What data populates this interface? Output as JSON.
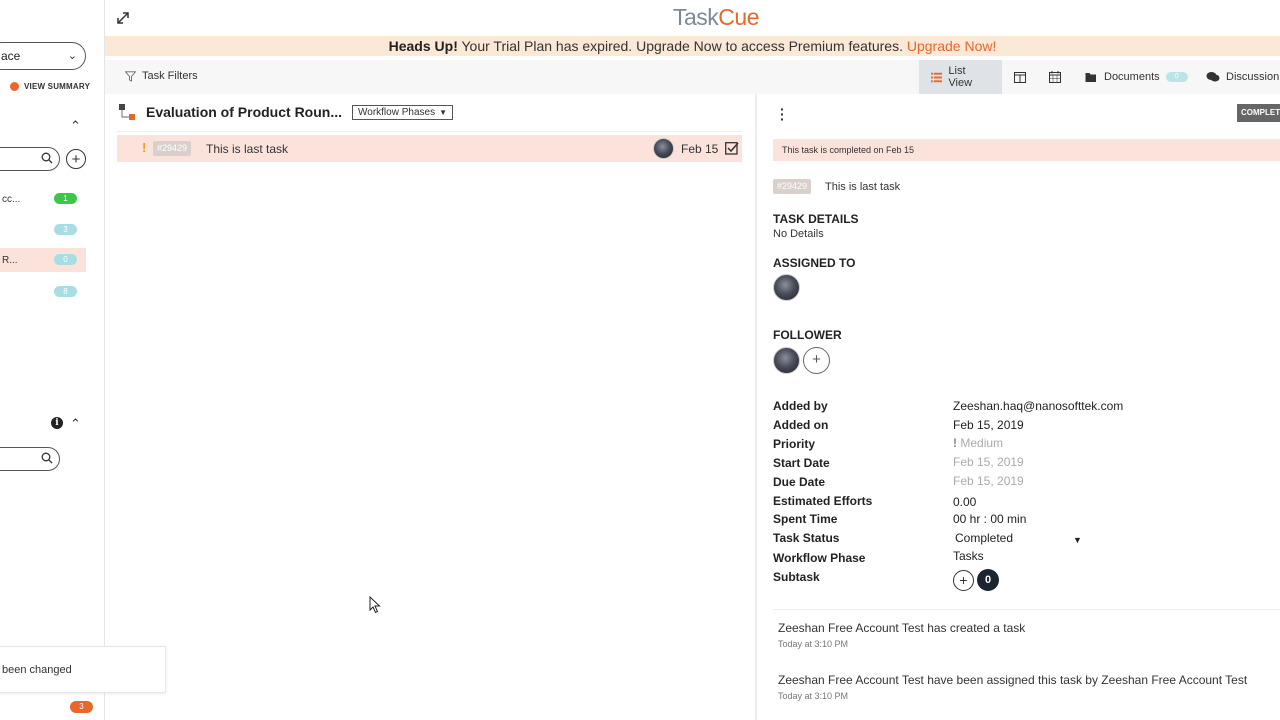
{
  "sidebar": {
    "workspace_label": "ace",
    "view_summary": "VIEW SUMMARY",
    "projects": [
      {
        "name": "cc...",
        "count": "1",
        "color": "#3cc74a"
      },
      {
        "name": "",
        "count": "3",
        "color": "#a8dde4"
      },
      {
        "name": "R...",
        "count": "0",
        "color": "#a8dde4"
      },
      {
        "name": "",
        "count": "8",
        "color": "#a8dde4"
      }
    ],
    "toast_text": "been changed",
    "bottom_badge": "3"
  },
  "header": {
    "logo_prefix": "Task",
    "logo_accent": "Cue"
  },
  "banner": {
    "bold": "Heads Up!",
    "message": " Your Trial Plan has expired. Upgrade Now to access Premium features. ",
    "link": "Upgrade Now!"
  },
  "toolbar": {
    "task_filters": "Task Filters",
    "list_view": "List View",
    "documents": "Documents",
    "documents_count": "0",
    "discussion": "Discussion"
  },
  "list": {
    "phase_title": "Evaluation of Product Roun...",
    "workflow_select": "Workflow Phases",
    "tasks": [
      {
        "id": "#29429",
        "name": "This is last task",
        "date": "Feb 15"
      }
    ]
  },
  "detail": {
    "status_tag": "COMPLETE",
    "completed_note": "This task is completed on Feb 15",
    "task_id": "#29429",
    "task_name": "This is last task",
    "task_details_label": "TASK DETAILS",
    "task_details_value": "No Details",
    "assigned_to_label": "ASSIGNED TO",
    "follower_label": "FOLLOWER",
    "props": {
      "added_by_label": "Added by",
      "added_by": "Zeeshan.haq@nanosofttek.com",
      "added_on_label": "Added on",
      "added_on": "Feb 15, 2019",
      "priority_label": "Priority",
      "priority": "Medium",
      "start_date_label": "Start Date",
      "start_date": "Feb 15, 2019",
      "due_date_label": "Due Date",
      "due_date": "Feb 15, 2019",
      "estimated_label": "Estimated Efforts",
      "estimated": "0.00",
      "spent_label": "Spent Time",
      "spent": "00 hr : 00 min",
      "status_label": "Task Status",
      "status": "Completed",
      "phase_label": "Workflow Phase",
      "phase": "Tasks",
      "subtask_label": "Subtask",
      "subtask_count": "0"
    },
    "activity": [
      {
        "text": "Zeeshan Free Account Test has created a task",
        "time": "Today at 3:10 PM"
      },
      {
        "text": "Zeeshan Free Account Test have been assigned this task by Zeeshan Free Account Test",
        "time": "Today at 3:10 PM"
      }
    ]
  },
  "colors": {
    "accent": "#e8672b",
    "banner_bg": "#fbe8d6",
    "row_highlight": "#fbe3dc"
  }
}
